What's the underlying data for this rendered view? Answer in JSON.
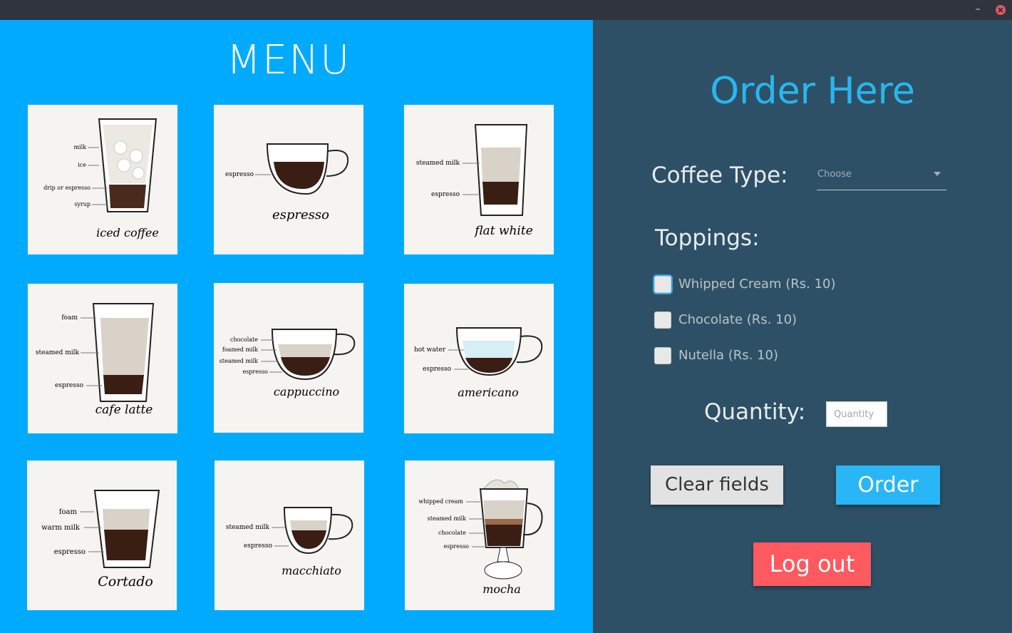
{
  "window": {
    "minimize_glyph": "–",
    "close_icon": "close-icon"
  },
  "menu": {
    "title": "MENU",
    "items": [
      {
        "name": "iced coffee",
        "labels": [
          "milk",
          "ice",
          "drip or espresso",
          "syrup"
        ]
      },
      {
        "name": "espresso",
        "labels": [
          "espresso"
        ]
      },
      {
        "name": "flat white",
        "labels": [
          "steamed milk",
          "espresso"
        ]
      },
      {
        "name": "cafe latte",
        "labels": [
          "foam",
          "steamed milk",
          "espresso"
        ]
      },
      {
        "name": "cappuccino",
        "labels": [
          "chocolate",
          "foamed milk",
          "steamed milk",
          "espresso"
        ]
      },
      {
        "name": "americano",
        "labels": [
          "hot water",
          "espresso"
        ]
      },
      {
        "name": "Cortado",
        "labels": [
          "foam",
          "warm milk",
          "espresso"
        ]
      },
      {
        "name": "macchiato",
        "labels": [
          "steamed milk",
          "espresso"
        ]
      },
      {
        "name": "mocha",
        "labels": [
          "whipped cream",
          "steamed milk",
          "chocolate",
          "espresso"
        ]
      }
    ]
  },
  "order": {
    "title": "Order Here",
    "coffee_type_label": "Coffee Type:",
    "coffee_type_value": "Choose",
    "toppings_label": "Toppings:",
    "toppings": [
      {
        "label": "Whipped Cream (Rs. 10)",
        "checked": false
      },
      {
        "label": "Chocolate (Rs. 10)",
        "checked": false
      },
      {
        "label": "Nutella (Rs. 10)",
        "checked": false
      }
    ],
    "quantity_label": "Quantity:",
    "quantity_placeholder": "Quantity",
    "clear_button": "Clear fields",
    "order_button": "Order",
    "logout_button": "Log out"
  },
  "colors": {
    "menu_bg": "#00aaff",
    "order_bg": "#2e5066",
    "accent": "#29b6f0",
    "logout": "#ff5a5f"
  }
}
